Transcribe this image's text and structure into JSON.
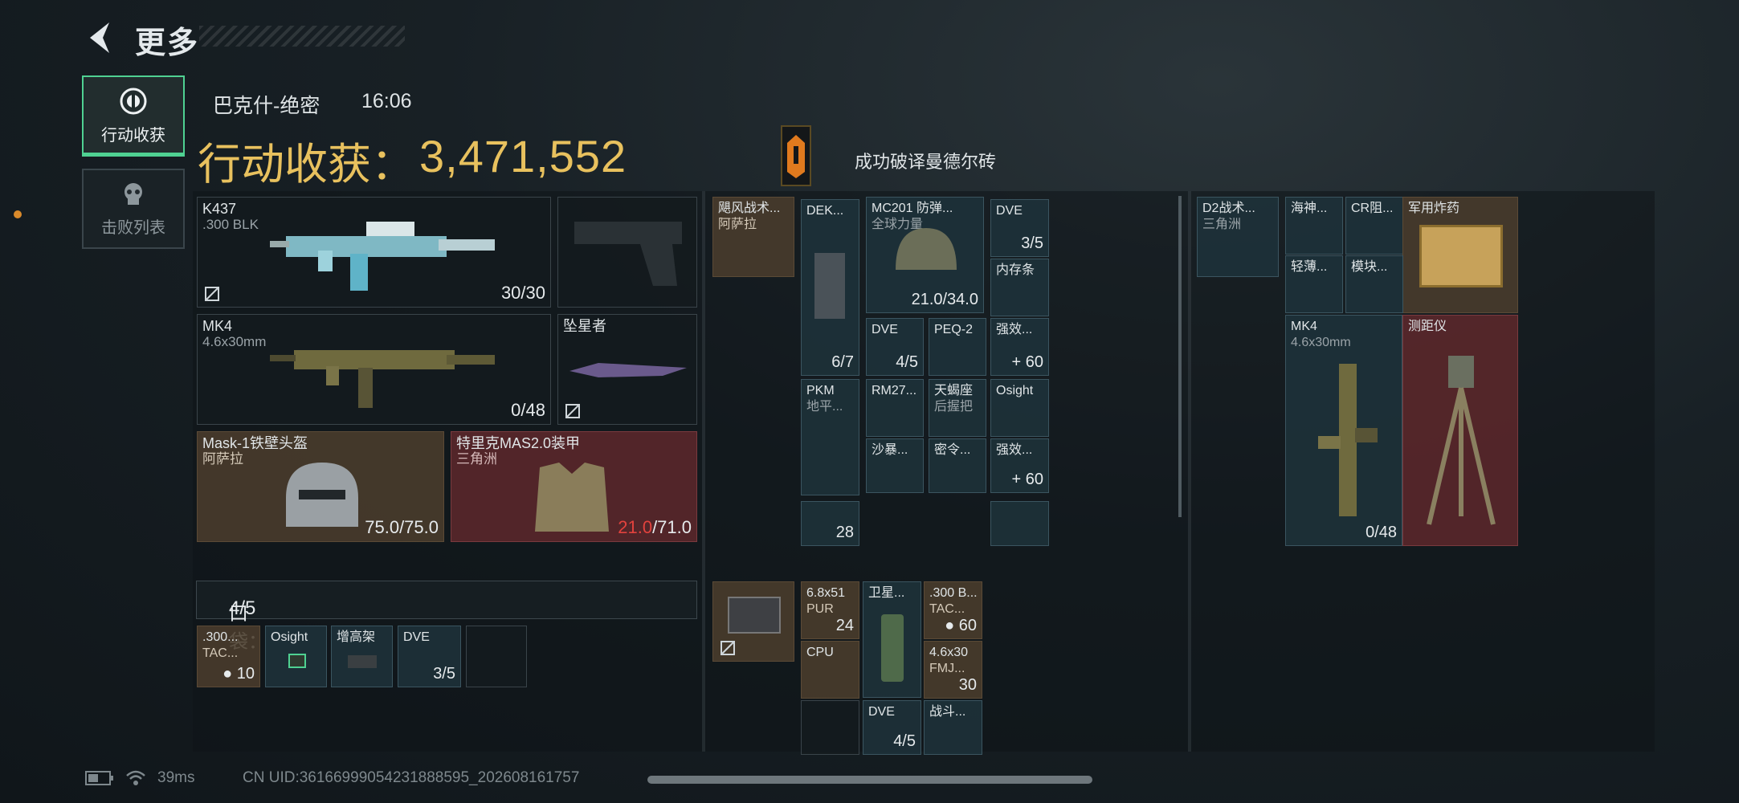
{
  "header": {
    "title": "更多"
  },
  "nav": [
    {
      "label": "行动收获",
      "icon": "target-icon",
      "active": true
    },
    {
      "label": "击败列表",
      "icon": "skull-icon",
      "active": false
    }
  ],
  "match": {
    "map": "巴克什-绝密",
    "time": "16:06"
  },
  "earnings": {
    "label": "行动收获：",
    "value": "3,471,552",
    "color": "#e8c15e"
  },
  "achievement": {
    "text": "成功破译曼德尔砖",
    "icon": "cipher-icon"
  },
  "equipment": {
    "primary": {
      "name": "K437",
      "sub": ".300 BLK",
      "count": "30/30"
    },
    "sidearm": {
      "name": ""
    },
    "secondary": {
      "name": "MK4",
      "sub": "4.6x30mm",
      "count": "0/48"
    },
    "melee": {
      "name": "坠星者"
    },
    "helmet": {
      "name": "Mask-1铁壁头盔",
      "sub": "阿萨拉",
      "count": "75.0/75.0"
    },
    "armor": {
      "name": "特里克MAS2.0装甲",
      "sub": "三角洲",
      "count_low": "21.0",
      "count_max": "/71.0"
    }
  },
  "pockets": {
    "label": "口袋：",
    "count": "4/5",
    "items": [
      {
        "name": ".300...",
        "sub": "TAC...",
        "count": "● 10"
      },
      {
        "name": "Osight",
        "count": ""
      },
      {
        "name": "增高架",
        "count": ""
      },
      {
        "name": "DVE",
        "count": "3/5"
      }
    ]
  },
  "chest": {
    "rig": {
      "name": "飓风战术...",
      "sub": "阿萨拉"
    },
    "items": [
      {
        "name": "DEK...",
        "count": "6/7"
      },
      {
        "name": "MC201 防弹...",
        "sub": "全球力量",
        "count": "21.0/34.0"
      },
      {
        "name": "DVE",
        "count": "3/5"
      },
      {
        "name": "内存条"
      },
      {
        "name": "DVE",
        "count": "4/5"
      },
      {
        "name": "PEQ-2"
      },
      {
        "name": "强效...",
        "count": "+ 60"
      },
      {
        "name": "PKM",
        "sub": "地平..."
      },
      {
        "name": "RM27..."
      },
      {
        "name": "天蝎座",
        "sub": "后握把"
      },
      {
        "name": "Osight"
      },
      {
        "name": "沙暴..."
      },
      {
        "name": "密令..."
      },
      {
        "name": "强效...",
        "count": "+ 60"
      },
      {
        "name": "",
        "count": "28"
      },
      {
        "name": ""
      }
    ]
  },
  "backpack": {
    "case": {
      "name": ""
    },
    "items": [
      {
        "name": "6.8x51",
        "sub": "PUR",
        "count": "24"
      },
      {
        "name": "卫星..."
      },
      {
        "name": ".300 B...",
        "sub": "TAC...",
        "count": "● 60"
      },
      {
        "name": "CPU"
      },
      {
        "name": "4.6x30",
        "sub": "FMJ...",
        "count": "30"
      },
      {
        "name": "DVE",
        "count": "4/5"
      },
      {
        "name": "战斗..."
      }
    ]
  },
  "stash": {
    "bag": {
      "name": "D2战术...",
      "sub": "三角洲"
    },
    "items": [
      {
        "name": "海神..."
      },
      {
        "name": "CR阻..."
      },
      {
        "name": "军用炸药"
      },
      {
        "name": "轻薄..."
      },
      {
        "name": "模块..."
      },
      {
        "name": "MK4",
        "sub": "4.6x30mm",
        "count": "0/48"
      },
      {
        "name": "测距仪"
      }
    ]
  },
  "status": {
    "ping": "39ms",
    "uid": "CN UID:3616699905423188859­5_202608161757"
  }
}
